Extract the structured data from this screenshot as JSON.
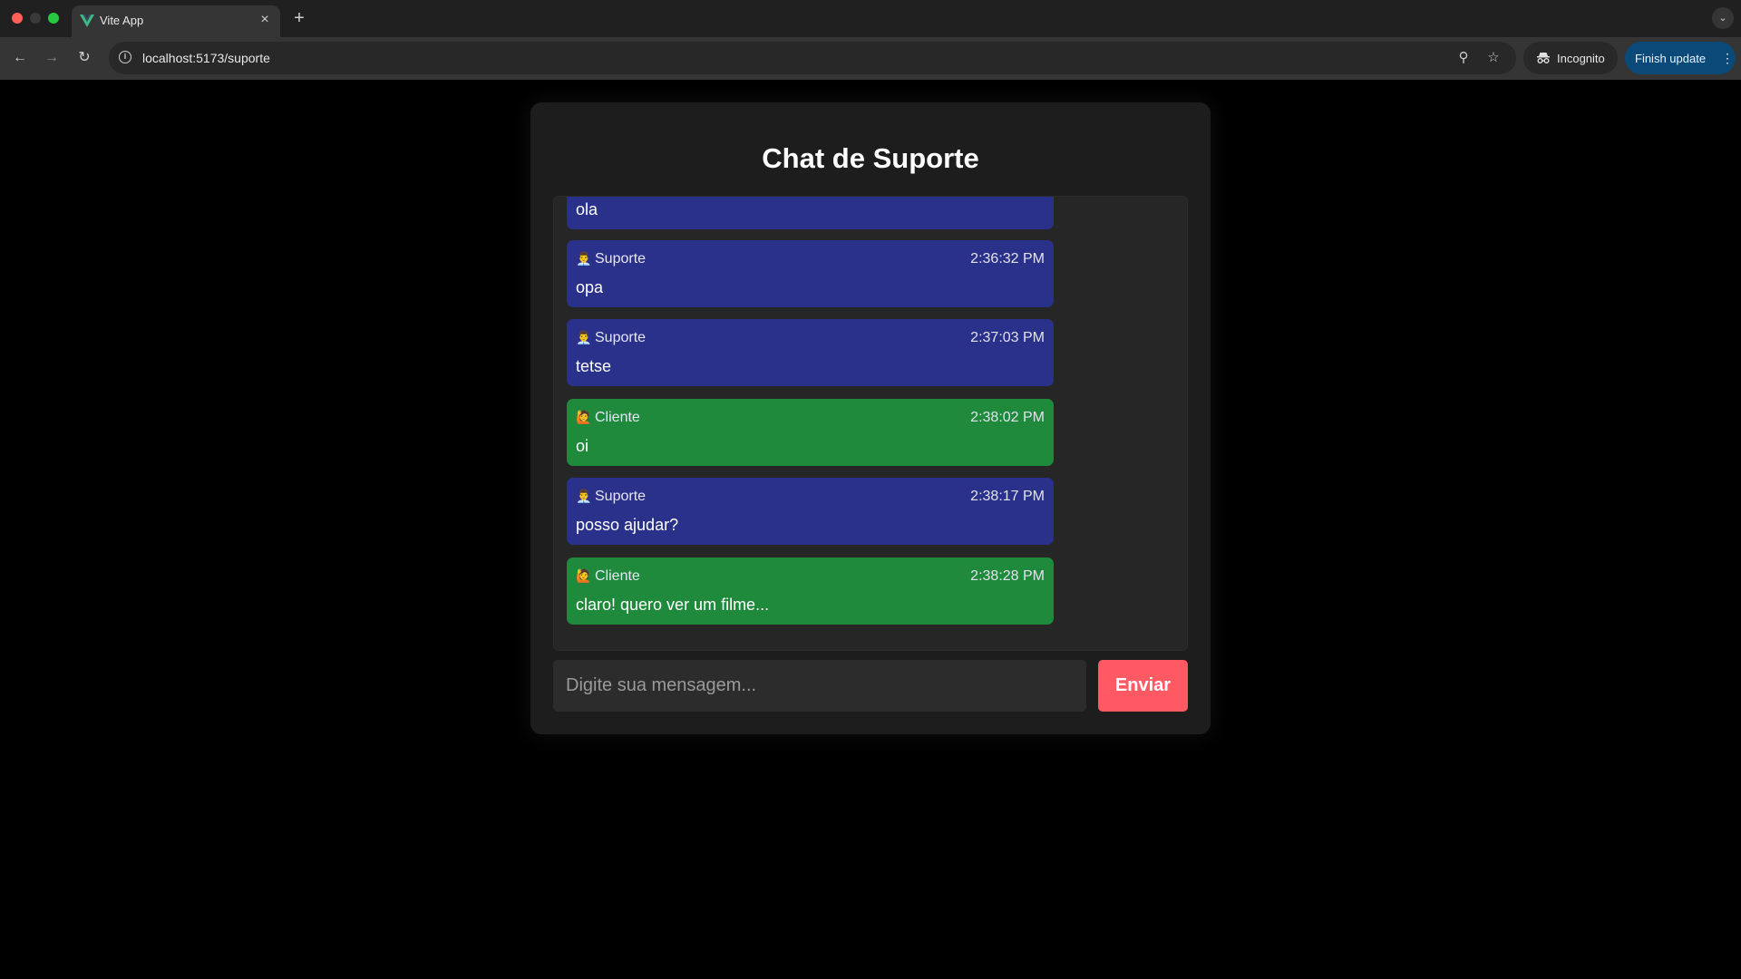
{
  "browser": {
    "tab_title": "Vite App",
    "tab_close_icon": "close-icon",
    "new_tab_icon": "plus-icon",
    "url": "localhost:5173/suporte",
    "incognito_label": "Incognito",
    "finish_update_label": "Finish update"
  },
  "chat": {
    "title": "Chat de Suporte",
    "messages": [
      {
        "author": "",
        "time": "",
        "text": "ola",
        "role": "suporte"
      },
      {
        "author": "Suporte",
        "time": "2:36:32 PM",
        "text": "opa",
        "role": "suporte"
      },
      {
        "author": "Suporte",
        "time": "2:37:03 PM",
        "text": "tetse",
        "role": "suporte"
      },
      {
        "author": "Cliente",
        "time": "2:38:02 PM",
        "text": "oi",
        "role": "cliente"
      },
      {
        "author": "Suporte",
        "time": "2:38:17 PM",
        "text": "posso ajudar?",
        "role": "suporte"
      },
      {
        "author": "Cliente",
        "time": "2:38:28 PM",
        "text": "claro! quero ver um filme...",
        "role": "cliente"
      }
    ],
    "input_placeholder": "Digite sua mensagem...",
    "send_label": "Enviar"
  },
  "colors": {
    "suporte_bubble": "#29318a",
    "cliente_bubble": "#1f8a3b",
    "send_button": "#ff5a64"
  }
}
